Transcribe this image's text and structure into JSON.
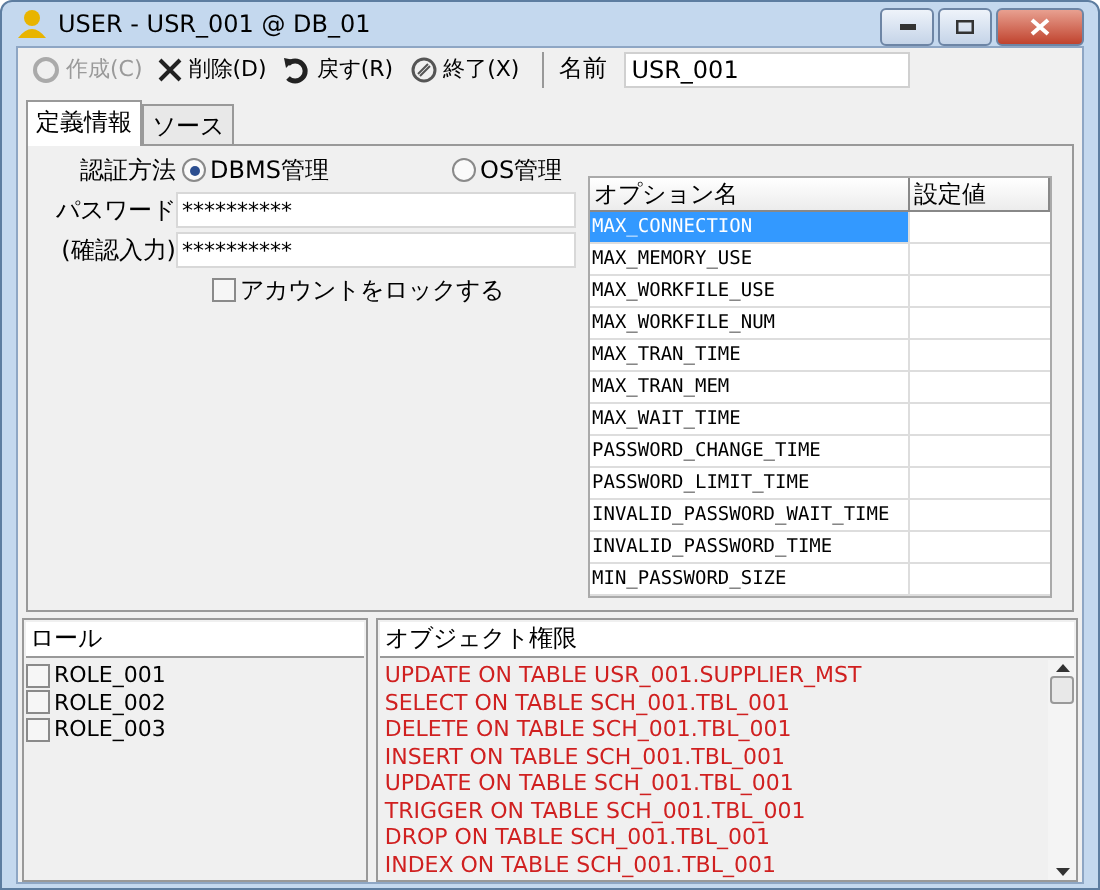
{
  "window": {
    "title": "USER - USR_001 @ DB_01"
  },
  "toolbar": {
    "buttons": [
      {
        "kind": "create",
        "label": "作成(C)",
        "disabled": true
      },
      {
        "kind": "delete",
        "label": "削除(D)",
        "disabled": false
      },
      {
        "kind": "undo",
        "label": "戻す(R)",
        "disabled": false
      },
      {
        "kind": "exit",
        "label": "終了(X)",
        "disabled": false
      }
    ],
    "name_label": "名前",
    "name_value": "USR_001"
  },
  "tabs": [
    {
      "label": "定義情報",
      "selected": true
    },
    {
      "label": "ソース",
      "selected": false
    }
  ],
  "auth": {
    "label": "認証方法",
    "options": [
      {
        "label": "DBMS管理",
        "selected": true
      },
      {
        "label": "OS管理",
        "selected": false
      }
    ]
  },
  "password": {
    "label": "パスワード",
    "value": "**********"
  },
  "confirm": {
    "label": "(確認入力)",
    "value": "**********"
  },
  "lock": {
    "label": "アカウントをロックする",
    "checked": false
  },
  "options_table": {
    "columns": [
      "オプション名",
      "設定値"
    ],
    "rows": [
      {
        "name": "MAX_CONNECTION",
        "selected": true
      },
      {
        "name": "MAX_MEMORY_USE",
        "selected": false
      },
      {
        "name": "MAX_WORKFILE_USE",
        "selected": false
      },
      {
        "name": "MAX_WORKFILE_NUM",
        "selected": false
      },
      {
        "name": "MAX_TRAN_TIME",
        "selected": false
      },
      {
        "name": "MAX_TRAN_MEM",
        "selected": false
      },
      {
        "name": "MAX_WAIT_TIME",
        "selected": false
      },
      {
        "name": "PASSWORD_CHANGE_TIME",
        "selected": false
      },
      {
        "name": "PASSWORD_LIMIT_TIME",
        "selected": false
      },
      {
        "name": "INVALID_PASSWORD_WAIT_TIME",
        "selected": false
      },
      {
        "name": "INVALID_PASSWORD_TIME",
        "selected": false
      },
      {
        "name": "MIN_PASSWORD_SIZE",
        "selected": false
      }
    ]
  },
  "roles": {
    "header": "ロール",
    "items": [
      {
        "label": "ROLE_001",
        "checked": false
      },
      {
        "label": "ROLE_002",
        "checked": false
      },
      {
        "label": "ROLE_003",
        "checked": false
      }
    ]
  },
  "privileges": {
    "header": "オブジェクト権限",
    "items": [
      "UPDATE ON TABLE USR_001.SUPPLIER_MST",
      "SELECT ON TABLE SCH_001.TBL_001",
      "DELETE ON TABLE SCH_001.TBL_001",
      "INSERT ON TABLE SCH_001.TBL_001",
      "UPDATE ON TABLE SCH_001.TBL_001",
      "TRIGGER ON TABLE SCH_001.TBL_001",
      "DROP ON TABLE SCH_001.TBL_001",
      "INDEX ON TABLE SCH_001.TBL_001"
    ]
  }
}
